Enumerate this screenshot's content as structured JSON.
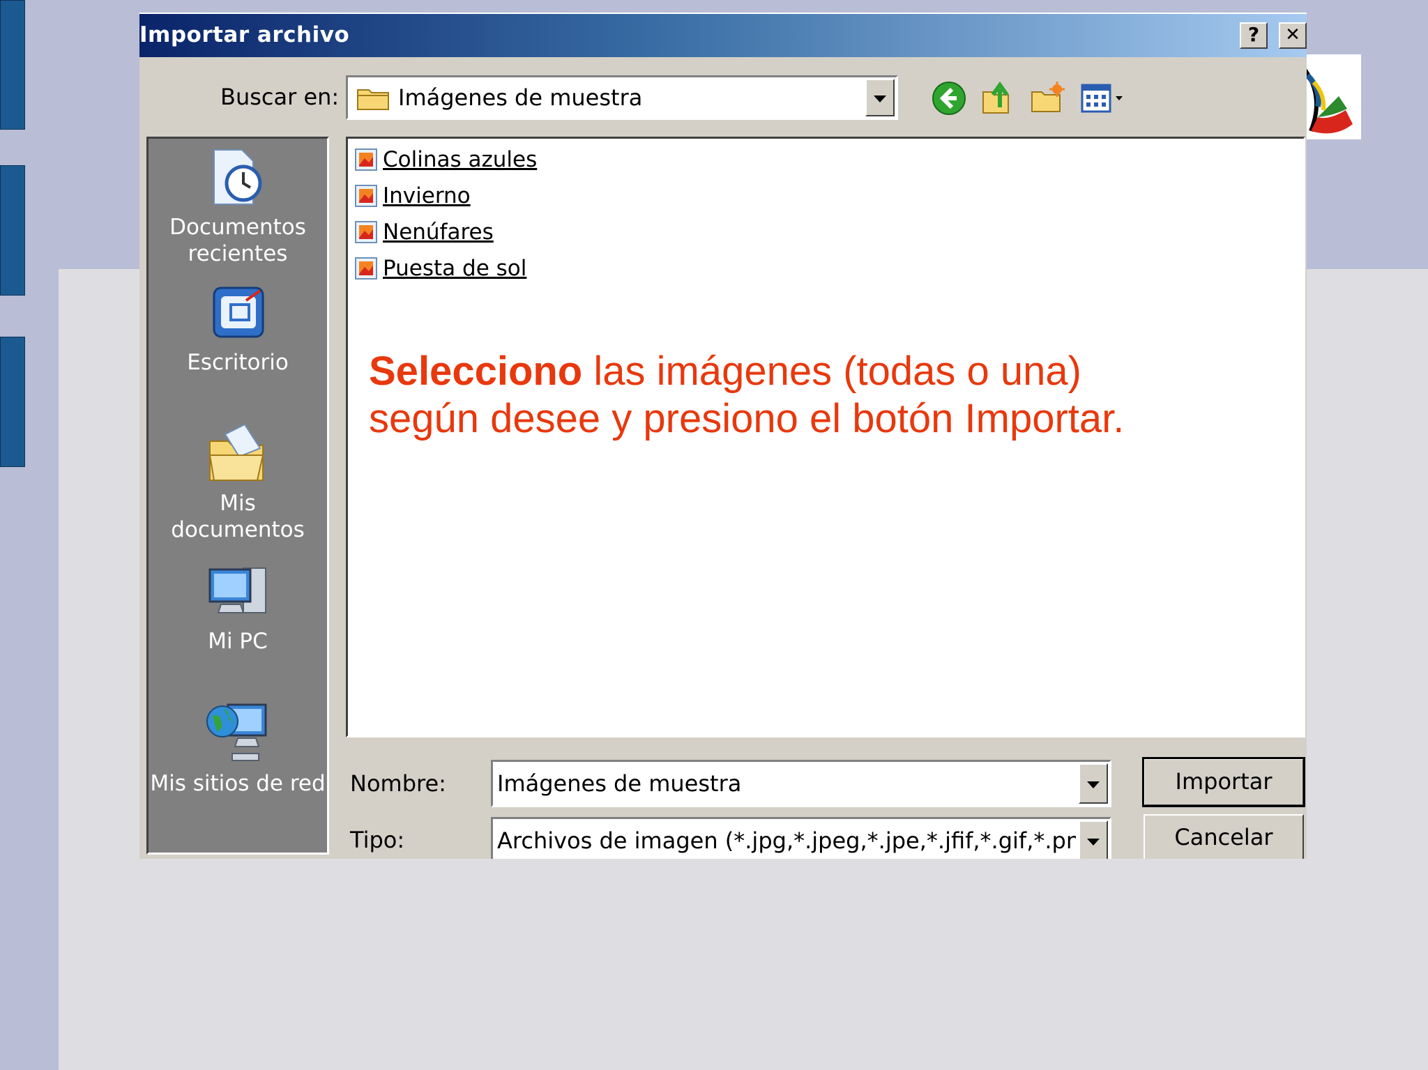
{
  "dialog": {
    "title": "Importar archivo",
    "help_label": "?",
    "close_label": "✕"
  },
  "lookin": {
    "label": "Buscar en:",
    "value": "Imágenes de muestra"
  },
  "toolbar": {
    "icons": [
      "back-icon",
      "up-folder-icon",
      "new-folder-icon",
      "view-menu-icon"
    ]
  },
  "places": [
    {
      "icon": "recent-documents-icon",
      "label_line1": "Documentos",
      "label_line2": "recientes"
    },
    {
      "icon": "desktop-icon",
      "label_line1": "Escritorio",
      "label_line2": ""
    },
    {
      "icon": "my-documents-icon",
      "label_line1": "Mis",
      "label_line2": "documentos"
    },
    {
      "icon": "my-computer-icon",
      "label_line1": "Mi PC",
      "label_line2": ""
    },
    {
      "icon": "network-places-icon",
      "label_line1": "Mis sitios de red",
      "label_line2": ""
    }
  ],
  "files": [
    {
      "name": "Colinas azules"
    },
    {
      "name": "Invierno"
    },
    {
      "name": "Nenúfares"
    },
    {
      "name": "Puesta de sol"
    }
  ],
  "annotation": {
    "bold": "Selecciono",
    "rest_line1": " las imágenes (todas o una)",
    "line2": "según desee y presiono el botón Importar."
  },
  "filename": {
    "label": "Nombre:",
    "value": "Imágenes de muestra"
  },
  "filetype": {
    "label": "Tipo:",
    "value": "Archivos de imagen (*.jpg,*.jpeg,*.jpe,*.jfif,*.gif,*.png,*.bm"
  },
  "buttons": {
    "import": "Importar",
    "cancel": "Cancelar"
  },
  "colors": {
    "annotation": "#e8380d",
    "title_bar_start": "#0a246a",
    "dialog_face": "#d4d0c8",
    "places_bar": "#808080",
    "slide_bars": "#1b5a90"
  }
}
